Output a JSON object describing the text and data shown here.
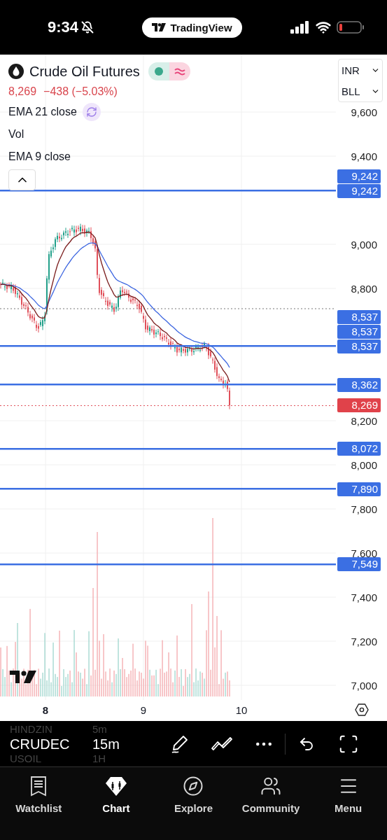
{
  "status_bar": {
    "time": "9:34",
    "app_pill": "TradingView"
  },
  "symbol": {
    "name": "Crude Oil Futures",
    "price": "8,269",
    "change": "−438 (−5.03%)",
    "market_open": true
  },
  "indicators": [
    {
      "label": "EMA 21 close",
      "syncing": true
    },
    {
      "label": "Vol",
      "syncing": false
    },
    {
      "label": "EMA 9 close",
      "syncing": false
    }
  ],
  "selectors": [
    {
      "label": "INR"
    },
    {
      "label": "BLL"
    }
  ],
  "y_axis": {
    "ticks": [
      "9,600",
      "9,400",
      "9,000",
      "8,800",
      "8,200",
      "8,000",
      "7,800",
      "7,600",
      "7,400",
      "7,200",
      "7,000"
    ]
  },
  "levels": [
    {
      "labels": [
        "9,242",
        "9,242"
      ],
      "kind": "line"
    },
    {
      "labels": [
        "8,537",
        "8,537",
        "8,537"
      ],
      "kind": "line"
    },
    {
      "labels": [
        "8,362"
      ],
      "kind": "line"
    },
    {
      "labels": [
        "8,269"
      ],
      "kind": "last_price"
    },
    {
      "labels": [
        "8,072"
      ],
      "kind": "line"
    },
    {
      "labels": [
        "7,890"
      ],
      "kind": "line"
    },
    {
      "labels": [
        "7,549"
      ],
      "kind": "line"
    }
  ],
  "x_axis": [
    {
      "label": "8",
      "emphasis": true
    },
    {
      "label": "9",
      "emphasis": false
    },
    {
      "label": "10",
      "emphasis": false
    }
  ],
  "toolbar": {
    "symbols": [
      {
        "label": "HINDZIN",
        "selected": false
      },
      {
        "label": "CRUDEC",
        "selected": true
      },
      {
        "label": "USOIL",
        "selected": false
      }
    ],
    "intervals": [
      {
        "label": "5m",
        "selected": false
      },
      {
        "label": "15m",
        "selected": true
      },
      {
        "label": "1H",
        "selected": false
      }
    ]
  },
  "tabs": [
    {
      "label": "Watchlist",
      "selected": false
    },
    {
      "label": "Chart",
      "selected": true
    },
    {
      "label": "Explore",
      "selected": false
    },
    {
      "label": "Community",
      "selected": false
    },
    {
      "label": "Menu",
      "selected": false
    }
  ]
}
